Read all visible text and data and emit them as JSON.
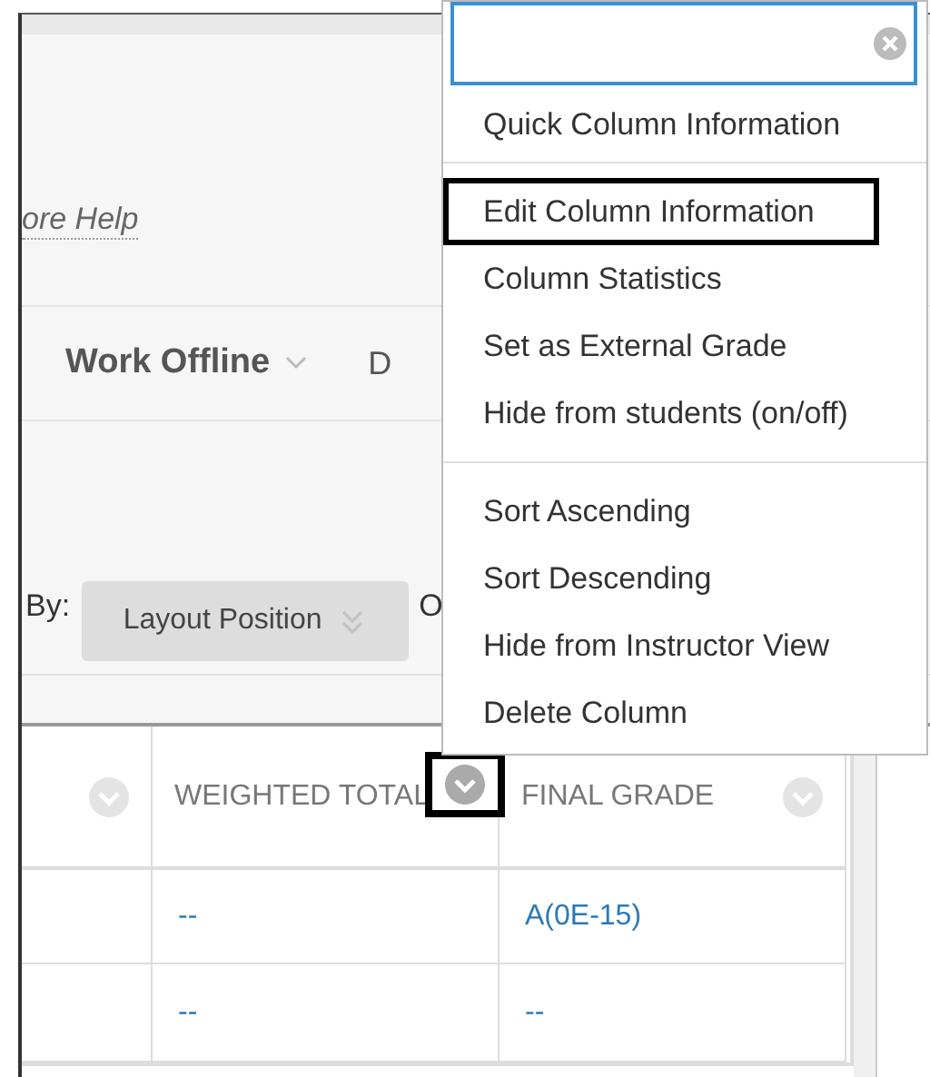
{
  "header": {
    "help_link": "ore Help"
  },
  "toolbar": {
    "work_offline": "Work Offline",
    "clipped_item": "D"
  },
  "sort_bar": {
    "label": "By:",
    "select": "Layout Position",
    "clipped_item": "O"
  },
  "table": {
    "columns": [
      {
        "kind": "clipped",
        "highlighted": false
      },
      {
        "kind": "labeled",
        "label": "WEIGHTED TOTAL",
        "highlighted": true
      },
      {
        "kind": "labeled",
        "label": "FINAL GRADE",
        "highlighted": false
      }
    ],
    "rows": [
      {
        "cells": [
          "",
          "--",
          "A(0E-15)"
        ]
      },
      {
        "cells": [
          "",
          "--",
          "--"
        ]
      }
    ]
  },
  "column_menu": {
    "groups": [
      [
        {
          "label": "Quick Column Information",
          "highlighted": false
        }
      ],
      [
        {
          "label": "Edit Column Information",
          "highlighted": true
        },
        {
          "label": "Column Statistics",
          "highlighted": false
        },
        {
          "label": "Set as External Grade",
          "highlighted": false
        },
        {
          "label": "Hide from students (on/off)",
          "highlighted": false
        }
      ],
      [
        {
          "label": "Sort Ascending",
          "highlighted": false
        },
        {
          "label": "Sort Descending",
          "highlighted": false
        },
        {
          "label": "Hide from Instructor View",
          "highlighted": false
        },
        {
          "label": "Delete Column",
          "highlighted": false
        }
      ]
    ]
  }
}
